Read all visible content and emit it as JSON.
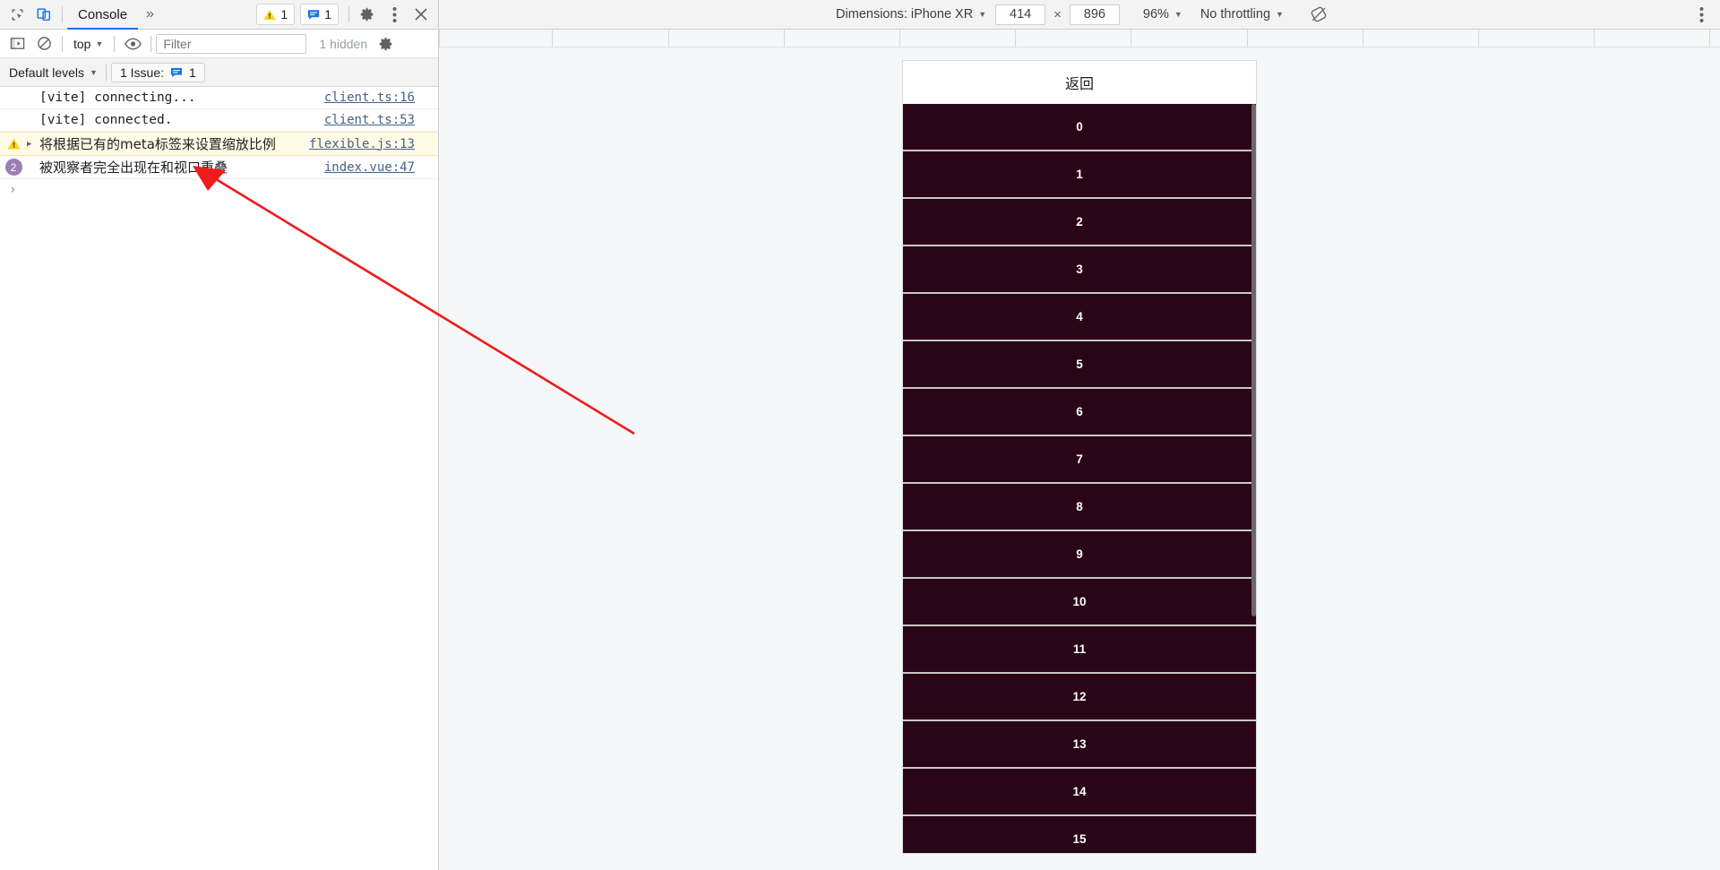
{
  "devtools": {
    "tabs": [
      {
        "label": "Console",
        "active": true
      }
    ],
    "more_tabs_label": "»",
    "icons": {
      "inspect": "inspect-element-icon",
      "device": "device-toolbar-icon",
      "settings": "gear-icon",
      "kebab": "more-options-icon",
      "close": "close-icon"
    },
    "badges": [
      {
        "name": "warning-badge",
        "icon": "warning-triangle-icon",
        "count": "1"
      },
      {
        "name": "issues-badge",
        "icon": "message-bubble-icon",
        "count": "1"
      }
    ],
    "filterbar": {
      "sidebar_toggle": "show-console-sidebar-icon",
      "clear": "clear-console-icon",
      "context": "top",
      "eye": "live-expression-icon",
      "filter_placeholder": "Filter",
      "filter_value": "",
      "hidden_text": "1 hidden",
      "settings": "console-settings-icon"
    },
    "levelsbar": {
      "levels_label": "Default levels",
      "issues_label": "1 Issue:",
      "issues_count": "1"
    },
    "messages": [
      {
        "kind": "log",
        "gutter": "",
        "expandable": false,
        "text": "[vite] connecting...",
        "source": "client.ts:16",
        "cjk": false
      },
      {
        "kind": "log",
        "gutter": "",
        "expandable": false,
        "text": "[vite] connected.",
        "source": "client.ts:53",
        "cjk": false
      },
      {
        "kind": "warn",
        "gutter": "warning-triangle-icon",
        "expandable": true,
        "text": "将根据已有的meta标签来设置缩放比例",
        "source": "flexible.js:13",
        "cjk": true
      },
      {
        "kind": "info",
        "gutter": "2",
        "expandable": false,
        "text": "被观察者完全出现在和视口重叠",
        "source": "index.vue:47",
        "cjk": true
      }
    ],
    "prompt_symbol": "›"
  },
  "device_toolbar": {
    "dimensions_label": "Dimensions: iPhone XR",
    "width_value": "414",
    "x_symbol": "×",
    "height_value": "896",
    "zoom_label": "96%",
    "throttling_label": "No throttling",
    "rotate_icon": "rotate-device-icon",
    "kebab_icon": "more-options-icon"
  },
  "page": {
    "header_title": "返回",
    "row_labels": [
      "0",
      "1",
      "2",
      "3",
      "4",
      "5",
      "6",
      "7",
      "8",
      "9",
      "10",
      "11",
      "12",
      "13",
      "14",
      "15"
    ],
    "row_bg": "#2a0417",
    "row_text_color": "#ffffff",
    "divider_color": "#c8c8c8"
  },
  "annotation": {
    "arrow": "red-annotation-arrow",
    "color": "#ee1c1c"
  }
}
